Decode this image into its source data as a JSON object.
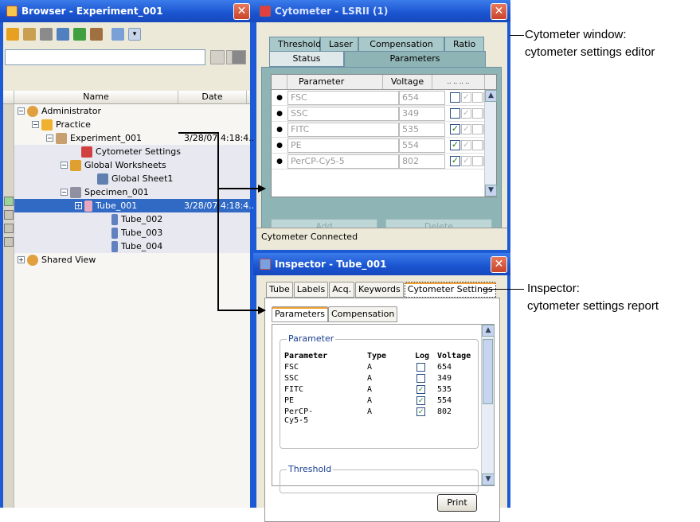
{
  "browser": {
    "title": "Browser - Experiment_001",
    "close": "✕",
    "columns": {
      "name": "Name",
      "date": "Date"
    },
    "tree": [
      {
        "label": "Administrator",
        "date": ""
      },
      {
        "label": "Practice",
        "date": ""
      },
      {
        "label": "Experiment_001",
        "date": "3/28/07 4:18:4..."
      },
      {
        "label": "Cytometer Settings",
        "date": ""
      },
      {
        "label": "Global Worksheets",
        "date": ""
      },
      {
        "label": "Global Sheet1",
        "date": ""
      },
      {
        "label": "Specimen_001",
        "date": ""
      },
      {
        "label": "Tube_001",
        "date": "3/28/07 4:18:4..."
      },
      {
        "label": "Tube_002",
        "date": ""
      },
      {
        "label": "Tube_003",
        "date": ""
      },
      {
        "label": "Tube_004",
        "date": ""
      },
      {
        "label": "Shared View",
        "date": ""
      }
    ]
  },
  "cytometer": {
    "title": "Cytometer - LSRII (1)",
    "close": "✕",
    "tabs_row1": [
      "Threshold",
      "Laser",
      "Compensation",
      "Ratio"
    ],
    "tabs_row2": [
      "Status",
      "Parameters"
    ],
    "table_headers": {
      "parameter": "Parameter",
      "voltage": "Voltage",
      "checks": ".. .. .. .."
    },
    "rows": [
      {
        "name": "FSC",
        "voltage": "654"
      },
      {
        "name": "SSC",
        "voltage": "349"
      },
      {
        "name": "FITC",
        "voltage": "535"
      },
      {
        "name": "PE",
        "voltage": "554"
      },
      {
        "name": "PerCP-Cy5-5",
        "voltage": "802"
      }
    ],
    "add_label": "Add",
    "delete_label": "Delete",
    "status": "Cytometer Connected"
  },
  "inspector": {
    "title": "Inspector - Tube_001",
    "close": "✕",
    "tabs": [
      "Tube",
      "Labels",
      "Acq.",
      "Keywords",
      "Cytometer Settings"
    ],
    "subtabs": [
      "Parameters",
      "Compensation"
    ],
    "group_parameter": "Parameter",
    "group_threshold": "Threshold",
    "headers": {
      "parameter": "Parameter",
      "type": "Type",
      "log": "Log",
      "voltage": "Voltage"
    },
    "rows": [
      {
        "name": "FSC",
        "type": "A",
        "log": false,
        "voltage": "654"
      },
      {
        "name": "SSC",
        "type": "A",
        "log": false,
        "voltage": "349"
      },
      {
        "name": "FITC",
        "type": "A",
        "log": true,
        "voltage": "535"
      },
      {
        "name": "PE",
        "type": "A",
        "log": true,
        "voltage": "554"
      },
      {
        "name": "PerCP-Cy5-5",
        "type": "A",
        "log": true,
        "voltage": "802"
      }
    ],
    "print_label": "Print"
  },
  "callouts": {
    "cytometer_line1": "Cytometer window:",
    "cytometer_line2": "cytometer settings editor",
    "inspector_line1": "Inspector:",
    "inspector_line2": "cytometer settings report"
  },
  "colors": {
    "titlebar": "#1d5bd6",
    "selection": "#316ac5",
    "panel_teal": "#8fb4b5",
    "close": "#d3502f"
  }
}
